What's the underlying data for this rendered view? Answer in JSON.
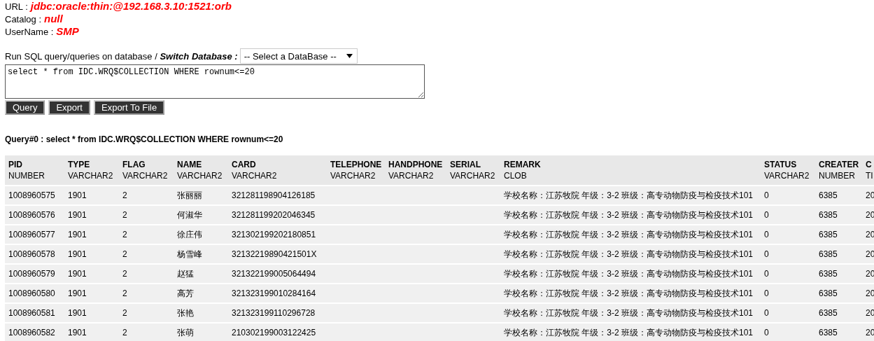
{
  "connection": [
    {
      "label": "URL :",
      "value": "jdbc:oracle:thin:@192.168.3.10:1521:orb"
    },
    {
      "label": "Catalog :",
      "value": "null"
    },
    {
      "label": "UserName :",
      "value": "SMP"
    }
  ],
  "query_form": {
    "prompt": "Run SQL query/queries on database / **Switch Database :**",
    "database_select": "-- Select a DataBase --",
    "sql": "select * from IDC.WRQ$COLLECTION WHERE rownum<=20",
    "buttons": [
      "Query",
      "Export",
      "Export To File"
    ]
  },
  "result_title": "Query#0 : select * from IDC.WRQ$COLLECTION WHERE rownum<=20",
  "table": {
    "columns": [
      {
        "name": "PID",
        "type": "NUMBER"
      },
      {
        "name": "TYPE",
        "type": "VARCHAR2"
      },
      {
        "name": "FLAG",
        "type": "VARCHAR2"
      },
      {
        "name": "NAME",
        "type": "VARCHAR2"
      },
      {
        "name": "CARD",
        "type": "VARCHAR2"
      },
      {
        "name": "TELEPHONE",
        "type": "VARCHAR2"
      },
      {
        "name": "HANDPHONE",
        "type": "VARCHAR2"
      },
      {
        "name": "SERIAL",
        "type": "VARCHAR2"
      },
      {
        "name": "REMARK",
        "type": "CLOB"
      },
      {
        "name": "STATUS",
        "type": "VARCHAR2"
      },
      {
        "name": "CREATER",
        "type": "NUMBER"
      },
      {
        "name": "C",
        "type": "TI"
      }
    ],
    "rows": [
      [
        "1008960575",
        "1901",
        "2",
        "张丽丽",
        "321281198904126185",
        "",
        "",
        "",
        "学校名称：江苏牧院 年级：3-2 班级：高专动物防疫与检疫技术101",
        "0",
        "6385",
        "20"
      ],
      [
        "1008960576",
        "1901",
        "2",
        "何淑华",
        "321281199202046345",
        "",
        "",
        "",
        "学校名称：江苏牧院 年级：3-2 班级：高专动物防疫与检疫技术101",
        "0",
        "6385",
        "20"
      ],
      [
        "1008960577",
        "1901",
        "2",
        "徐庄伟",
        "321302199202180851",
        "",
        "",
        "",
        "学校名称：江苏牧院 年级：3-2 班级：高专动物防疫与检疫技术101",
        "0",
        "6385",
        "20"
      ],
      [
        "1008960578",
        "1901",
        "2",
        "杨雪峰",
        "32132219890421501X",
        "",
        "",
        "",
        "学校名称：江苏牧院 年级：3-2 班级：高专动物防疫与检疫技术101",
        "0",
        "6385",
        "20"
      ],
      [
        "1008960579",
        "1901",
        "2",
        "赵猛",
        "321322199005064494",
        "",
        "",
        "",
        "学校名称：江苏牧院 年级：3-2 班级：高专动物防疫与检疫技术101",
        "0",
        "6385",
        "20"
      ],
      [
        "1008960580",
        "1901",
        "2",
        "高芳",
        "321323199010284164",
        "",
        "",
        "",
        "学校名称：江苏牧院 年级：3-2 班级：高专动物防疫与检疫技术101",
        "0",
        "6385",
        "20"
      ],
      [
        "1008960581",
        "1901",
        "2",
        "张艳",
        "321323199110296728",
        "",
        "",
        "",
        "学校名称：江苏牧院 年级：3-2 班级：高专动物防疫与检疫技术101",
        "0",
        "6385",
        "20"
      ],
      [
        "1008960582",
        "1901",
        "2",
        "张萌",
        "210302199003122425",
        "",
        "",
        "",
        "学校名称：江苏牧院 年级：3-2 班级：高专动物防疫与检疫技术101",
        "0",
        "6385",
        "20"
      ]
    ]
  }
}
